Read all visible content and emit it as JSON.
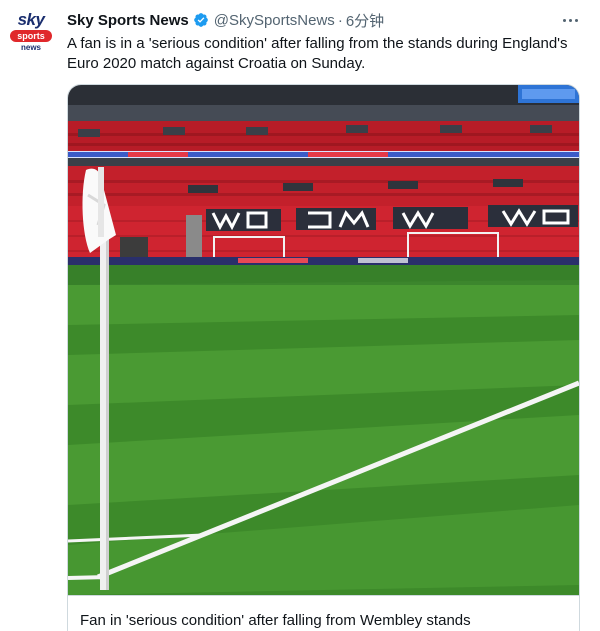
{
  "account": {
    "name": "Sky Sports News",
    "handle": "@SkySportsNews",
    "separator": "·",
    "time": "6分钟",
    "avatar": {
      "line1": "sky",
      "line2": "sports",
      "line3": "news"
    }
  },
  "tweet": {
    "text": "A fan is in a 'serious condition' after falling from the stands during England's Euro 2020 match against Croatia on Sunday."
  },
  "card": {
    "caption": "Fan in 'serious condition' after falling from Wembley stands"
  },
  "colors": {
    "verified": "#1d9bf0",
    "seats": "#c8202b",
    "pitch": "#3f8a2c",
    "border": "#cfd9de"
  },
  "icons": [
    "verified-badge-icon",
    "more-options-icon",
    "corner-flag"
  ]
}
